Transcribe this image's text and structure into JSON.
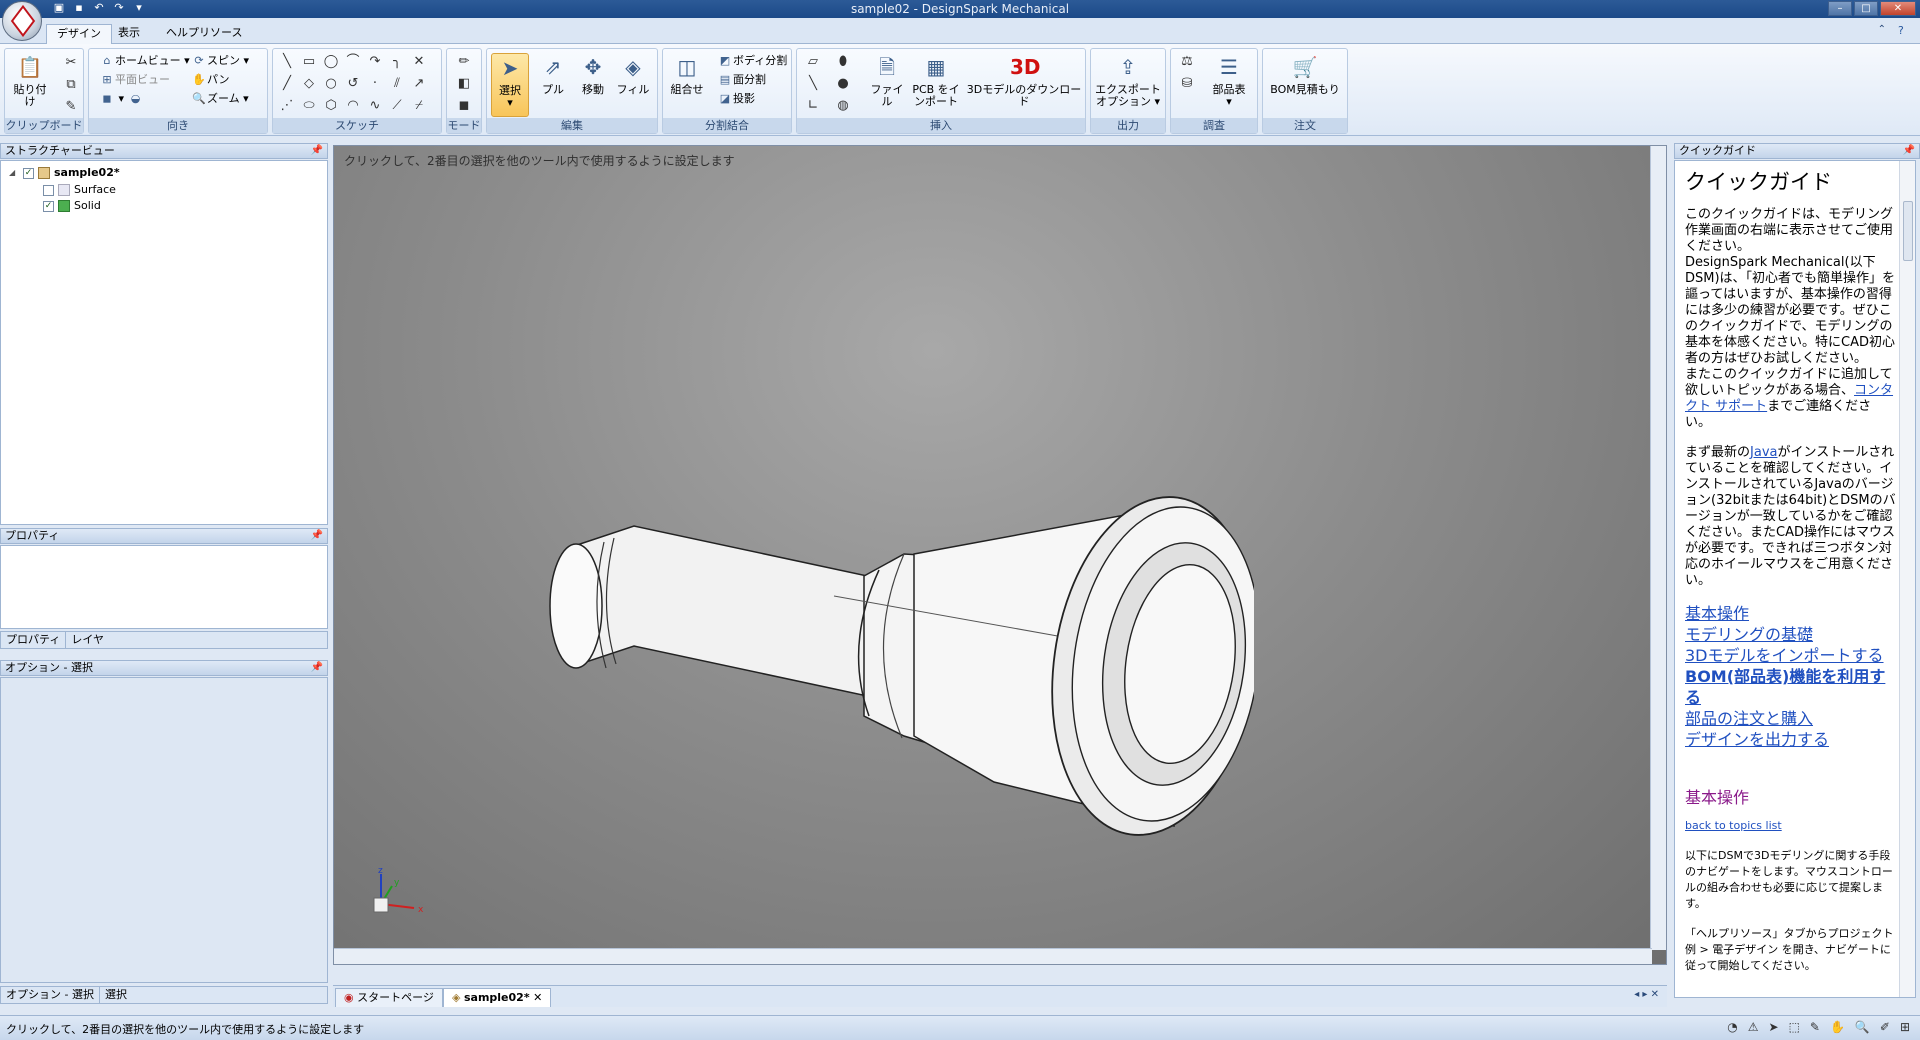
{
  "window": {
    "title": "sample02 - DesignSpark Mechanical"
  },
  "tabs": [
    {
      "label": "デザイン"
    },
    {
      "label": "表示"
    },
    {
      "label": "ヘルプリソース"
    }
  ],
  "ribbon": {
    "clipboard": {
      "paste": "貼り付け",
      "group": "クリップボード"
    },
    "orient": {
      "home": "ホームビュー",
      "plan": "平面ビュー",
      "spin": "スピン",
      "pan": "パン",
      "zoom": "ズーム",
      "group": "向き"
    },
    "sketch": {
      "group": "スケッチ"
    },
    "mode": {
      "group": "モード"
    },
    "edit": {
      "select": "選択",
      "pull": "プル",
      "move": "移動",
      "fill": "フィル",
      "group": "編集"
    },
    "intersect": {
      "combine": "組合せ",
      "split_body": "ボディ分割",
      "split_face": "面分割",
      "project": "投影",
      "group": "分割結合"
    },
    "insert": {
      "file": "ファイル",
      "pcb1": "PCB をイ",
      "pcb2": "ンポート",
      "download": "3Dモデルのダウンロード",
      "group": "挿入"
    },
    "output": {
      "export1": "エクスポート",
      "export2": "オプション",
      "group": "出力"
    },
    "investigate": {
      "bom": "部品表",
      "group": "調査"
    },
    "order": {
      "quote": "BOM見積もり",
      "group": "注文"
    }
  },
  "structure": {
    "title": "ストラクチャービュー",
    "root": "sample02*",
    "items": [
      {
        "label": "Surface",
        "checked": false
      },
      {
        "label": "Solid",
        "checked": true
      }
    ]
  },
  "properties": {
    "title": "プロパティ",
    "tabs": [
      "プロパティ",
      "レイヤ"
    ]
  },
  "options": {
    "title": "オプション - 選択",
    "tabs": [
      "オプション - 選択",
      "選択"
    ]
  },
  "viewport": {
    "hint": "クリックして、2番目の選択を他のツール内で使用するように設定します",
    "axes": [
      "z",
      "y",
      "x"
    ]
  },
  "doc_tabs": [
    {
      "label": "スタートページ"
    },
    {
      "label": "sample02*"
    }
  ],
  "quickguide": {
    "panel_title": "クイックガイド",
    "heading": "クイックガイド",
    "intro1": "このクイックガイドは、モデリング作業画面の右端に表示させてご使用ください。",
    "intro2": "DesignSpark Mechanical(以下DSM)は、「初心者でも簡単操作」を謳ってはいますが、基本操作の習得には多少の練習が必要です。ぜひこのクイックガイドで、モデリングの基本を体感ください。特にCAD初心者の方はぜひお試しください。",
    "intro3_pre": "またこのクイックガイドに追加して欲しいトピックがある場合、",
    "intro3_link": "コンタクト サポート",
    "intro3_post": "までご連絡ください。",
    "java_pre": "まず最新の",
    "java_link": "Java",
    "java_post": "がインストールされていることを確認してください。インストールされているJavaのバージョン(32bitまたは64bit)とDSMのバージョンが一致しているかをご確認ください。またCAD操作にはマウスが必要です。できれば三つボタン対応のホイールマウスをご用意ください。",
    "topics": [
      {
        "label": "基本操作",
        "style": "purple"
      },
      {
        "label": "モデリングの基礎",
        "style": "red"
      },
      {
        "label": "3Dモデルをインポートする",
        "style": "blue"
      },
      {
        "label": "BOM(部品表)機能を利用する",
        "style": "green"
      },
      {
        "label": "部品の注文と購入",
        "style": "blue2"
      },
      {
        "label": "デザインを出力する",
        "style": "red2"
      }
    ],
    "section_title": "基本操作",
    "back_link": "back to topics list",
    "section_text": "以下にDSMで3Dモデリングに関する手段のナビゲートをします。マウスコントロールの組み合わせも必要に応じて提案します。",
    "section_text2": "「ヘルプリソース」タブからプロジェクト例 > 電子デザイン を開き、ナビゲートに従って開始してください。"
  },
  "status": {
    "text": "クリックして、2番目の選択を他のツール内で使用するように設定します"
  }
}
